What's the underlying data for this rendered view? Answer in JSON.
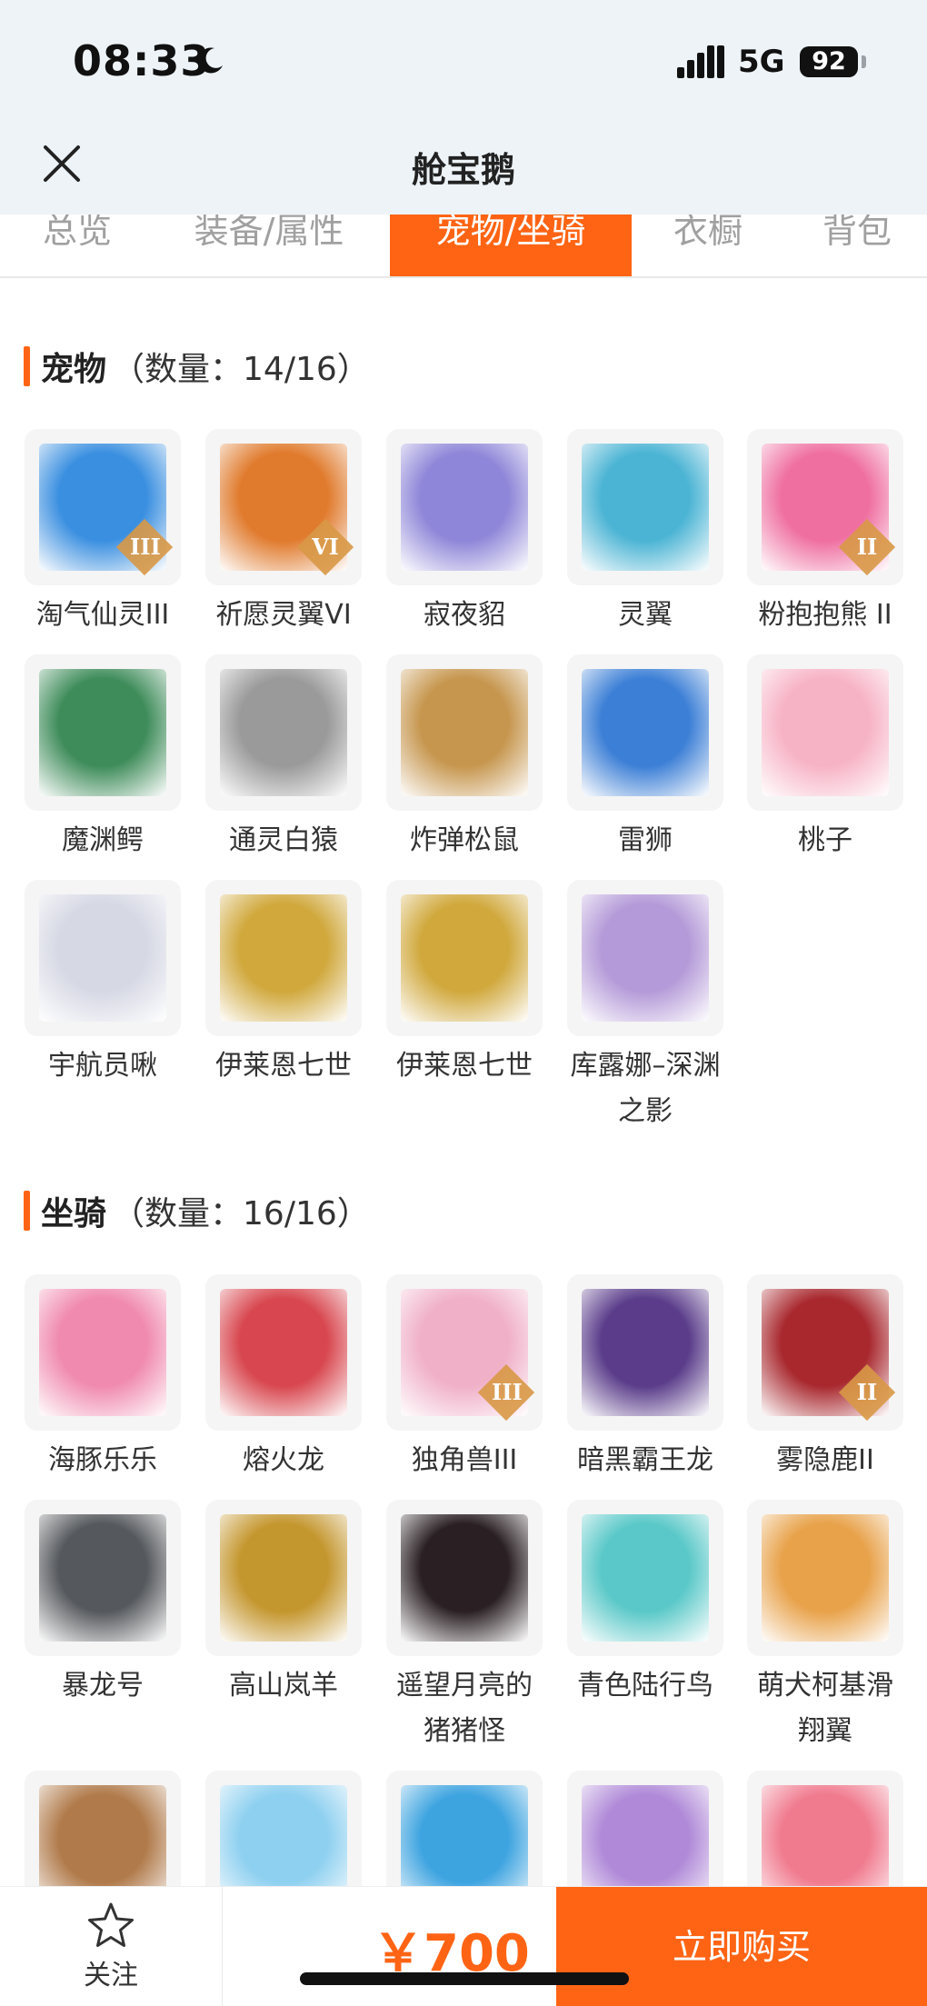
{
  "status": {
    "time": "08:33",
    "network": "5G",
    "battery": "92"
  },
  "header": {
    "title": "舱宝鹅"
  },
  "tabs": [
    {
      "label": "总览"
    },
    {
      "label": "装备/属性"
    },
    {
      "label": "宠物/坐骑"
    },
    {
      "label": "衣橱"
    },
    {
      "label": "背包"
    }
  ],
  "pets": {
    "title": "宠物",
    "count": "（数量：14/16）",
    "items": [
      {
        "name": "淘气仙灵III",
        "tier": "III",
        "color": "#3a8fe0"
      },
      {
        "name": "祈愿灵翼VI",
        "tier": "VI",
        "color": "#e07a2c"
      },
      {
        "name": "寂夜貂",
        "tier": "",
        "color": "#8e86d8"
      },
      {
        "name": "灵翼",
        "tier": "",
        "color": "#4bb4d4"
      },
      {
        "name": "粉抱抱熊 II",
        "tier": "II",
        "color": "#ef6fa0"
      },
      {
        "name": "魔渊鳄",
        "tier": "",
        "color": "#3e8c5a"
      },
      {
        "name": "通灵白猿",
        "tier": "",
        "color": "#9a9a9a"
      },
      {
        "name": "炸弹松鼠",
        "tier": "",
        "color": "#c6964e"
      },
      {
        "name": "雷狮",
        "tier": "",
        "color": "#3c7fd6"
      },
      {
        "name": "桃子",
        "tier": "",
        "color": "#f7b3c6"
      },
      {
        "name": "宇航员啾",
        "tier": "",
        "color": "#d6d8e4"
      },
      {
        "name": "伊莱恩七世",
        "tier": "",
        "color": "#d0a83c"
      },
      {
        "name": "伊莱恩七世",
        "tier": "",
        "color": "#d0a83c"
      },
      {
        "name": "库露娜–深渊之影",
        "tier": "",
        "color": "#b49ad8"
      }
    ]
  },
  "mounts": {
    "title": "坐骑",
    "count": "（数量：16/16）",
    "items": [
      {
        "name": "海豚乐乐",
        "tier": "",
        "color": "#f08aae"
      },
      {
        "name": "熔火龙",
        "tier": "",
        "color": "#d8474f"
      },
      {
        "name": "独角兽III",
        "tier": "III",
        "color": "#f0b0c8"
      },
      {
        "name": "暗黑霸王龙",
        "tier": "",
        "color": "#5a3c8a"
      },
      {
        "name": "雾隐鹿II",
        "tier": "II",
        "color": "#a8282e"
      },
      {
        "name": "暴龙号",
        "tier": "",
        "color": "#55585c"
      },
      {
        "name": "高山岚羊",
        "tier": "",
        "color": "#c4962e"
      },
      {
        "name": "遥望月亮的猪猪怪",
        "tier": "",
        "color": "#2a2024"
      },
      {
        "name": "青色陆行鸟",
        "tier": "",
        "color": "#5ac8c8"
      },
      {
        "name": "萌犬柯基滑翔翼",
        "tier": "",
        "color": "#e8a24a"
      },
      {
        "name": "",
        "tier": "",
        "color": "#b07a4a"
      },
      {
        "name": "",
        "tier": "",
        "color": "#8ed0f0"
      },
      {
        "name": "",
        "tier": "",
        "color": "#3ea4e0"
      },
      {
        "name": "",
        "tier": "",
        "color": "#b08ad8"
      },
      {
        "name": "",
        "tier": "",
        "color": "#f07a8e"
      }
    ]
  },
  "bottom": {
    "favorite_label": "关注",
    "price": "￥700",
    "buy_label": "立即购买"
  },
  "colors": {
    "accent": "#ff6414",
    "header_bg": "#edf3f7",
    "card_bg": "#f5f5f5"
  }
}
